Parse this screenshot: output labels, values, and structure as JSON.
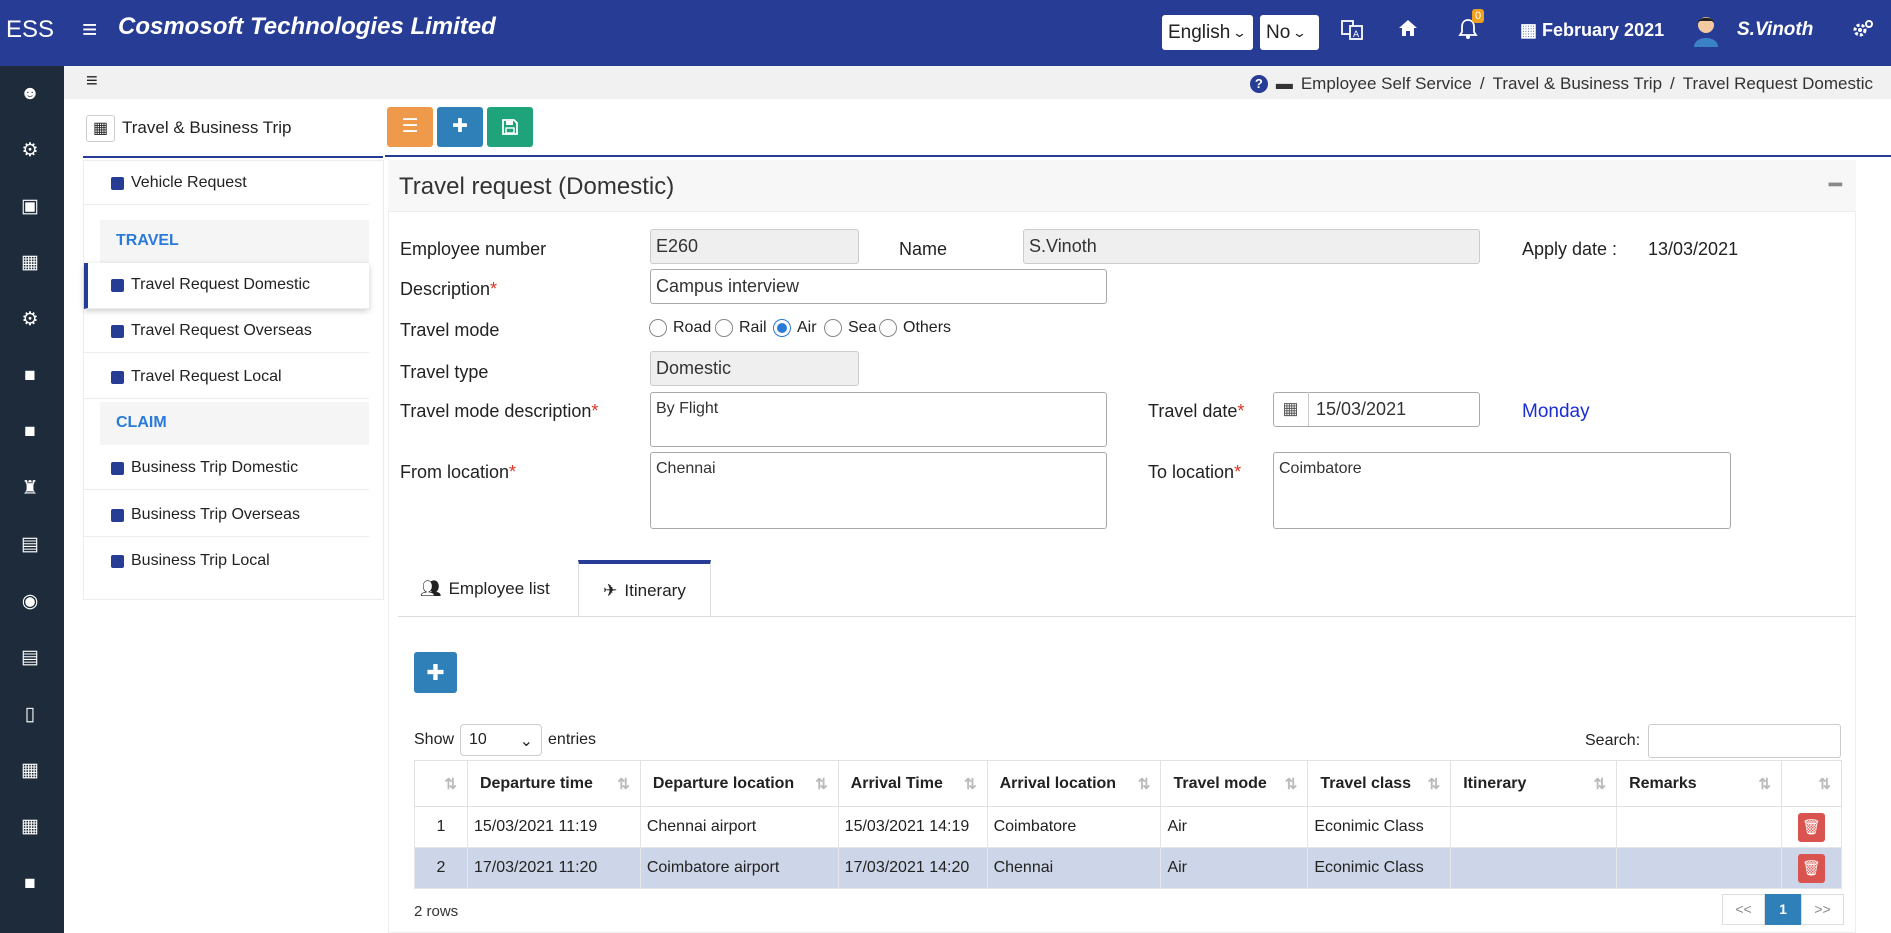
{
  "header": {
    "brand": "ESS",
    "company": "Cosmosoft Technologies Limited",
    "language": "English",
    "yesno": "No",
    "notification_count": "0",
    "period": "February 2021",
    "user": "S.Vinoth"
  },
  "breadcrumb": [
    "Employee Self Service",
    "/",
    "Travel & Business Trip",
    "/",
    "Travel Request Domestic"
  ],
  "sidemenu": {
    "title": "Travel & Business Trip",
    "items": [
      {
        "label": "Vehicle Request"
      },
      {
        "section": "TRAVEL"
      },
      {
        "label": "Travel Request Domestic"
      },
      {
        "label": "Travel Request Overseas"
      },
      {
        "label": "Travel Request Local"
      },
      {
        "section": "CLAIM"
      },
      {
        "label": "Business Trip Domestic"
      },
      {
        "label": "Business Trip Overseas"
      },
      {
        "label": "Business Trip Local"
      }
    ]
  },
  "form": {
    "title": "Travel request (Domestic)",
    "employee_number_label": "Employee number",
    "employee_number": "E260",
    "name_label": "Name",
    "name": "S.Vinoth",
    "apply_date_label": "Apply date :",
    "apply_date": "13/03/2021",
    "description_label": "Description",
    "description": "Campus interview",
    "travel_mode_label": "Travel mode",
    "travel_modes": [
      "Road",
      "Rail",
      "Air",
      "Sea",
      "Others"
    ],
    "travel_mode_selected": "Air",
    "travel_type_label": "Travel type",
    "travel_type": "Domestic",
    "travel_mode_desc_label": "Travel mode description",
    "travel_mode_desc": "By Flight",
    "travel_date_label": "Travel date",
    "travel_date": "15/03/2021",
    "travel_day": "Monday",
    "from_label": "From location",
    "from": "Chennai",
    "to_label": "To location",
    "to": "Coimbatore",
    "required_mark": "*"
  },
  "tabs": {
    "employee_list": "Employee list",
    "itinerary": "Itinerary"
  },
  "table": {
    "show": "Show",
    "page_size": "10",
    "entries": "entries",
    "search": "Search:",
    "columns": [
      "Departure time",
      "Departure location",
      "Arrival Time",
      "Arrival location",
      "Travel mode",
      "Travel class",
      "Itinerary",
      "Remarks"
    ],
    "rows": [
      {
        "no": "1",
        "dep_time": "15/03/2021 11:19",
        "dep_loc": "Chennai airport",
        "arr_time": "15/03/2021 14:19",
        "arr_loc": "Coimbatore",
        "mode": "Air",
        "class": "Econimic Class",
        "itinerary": "",
        "remarks": ""
      },
      {
        "no": "2",
        "dep_time": "17/03/2021 11:20",
        "dep_loc": "Coimbatore airport",
        "arr_time": "17/03/2021 14:20",
        "arr_loc": "Chennai",
        "mode": "Air",
        "class": "Econimic Class",
        "itinerary": "",
        "remarks": ""
      }
    ],
    "rows_count": "2 rows",
    "pager": [
      "<<",
      "1",
      ">>"
    ]
  }
}
